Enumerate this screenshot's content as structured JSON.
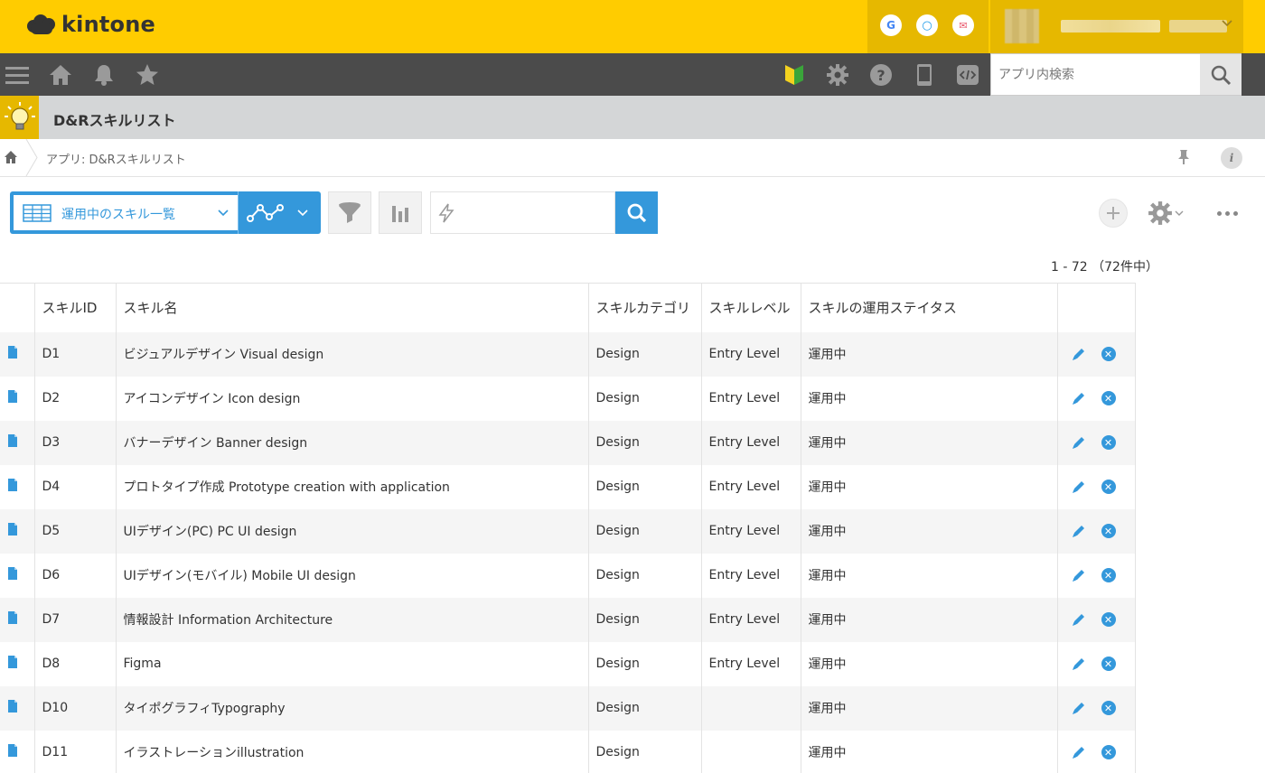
{
  "brand": {
    "name": "kintone"
  },
  "services": [
    {
      "name": "google-icon",
      "glyph": "G",
      "color": "#4285f4"
    },
    {
      "name": "garoon-icon",
      "glyph": "○",
      "color": "#1e9be9"
    },
    {
      "name": "mail-icon",
      "glyph": "✉",
      "color": "#e8566b"
    }
  ],
  "search": {
    "placeholder": "アプリ内検索"
  },
  "app": {
    "title": "D&Rスキルリスト"
  },
  "breadcrumb": {
    "text": "アプリ: D&Rスキルリスト"
  },
  "view": {
    "selected": "運用中のスキル一覧"
  },
  "record_count": "1 - 72 （72件中）",
  "table": {
    "headers": [
      "スキルID",
      "スキル名",
      "スキルカテゴリ",
      "スキルレベル",
      "スキルの運用ステイタス"
    ],
    "rows": [
      [
        "D1",
        "ビジュアルデザイン Visual design",
        "Design",
        "Entry Level",
        "運用中"
      ],
      [
        "D2",
        "アイコンデザイン Icon design",
        "Design",
        "Entry Level",
        "運用中"
      ],
      [
        "D3",
        "バナーデザイン Banner design",
        "Design",
        "Entry Level",
        "運用中"
      ],
      [
        "D4",
        "プロトタイプ作成 Prototype creation with application",
        "Design",
        "Entry Level",
        "運用中"
      ],
      [
        "D5",
        "UIデザイン(PC) PC UI design",
        "Design",
        "Entry Level",
        "運用中"
      ],
      [
        "D6",
        "UIデザイン(モバイル) Mobile UI design",
        "Design",
        "Entry Level",
        "運用中"
      ],
      [
        "D7",
        "情報設計 Information Architecture",
        "Design",
        "Entry Level",
        "運用中"
      ],
      [
        "D8",
        "Figma",
        "Design",
        "Entry Level",
        "運用中"
      ],
      [
        "D10",
        "タイポグラフィTypography",
        "Design",
        "",
        "運用中"
      ],
      [
        "D11",
        "イラストレーションillustration",
        "Design",
        "",
        "運用中"
      ]
    ]
  },
  "colors": {
    "header": "#ffcc00",
    "nav": "#4b4b4b",
    "accent": "#3498db"
  }
}
